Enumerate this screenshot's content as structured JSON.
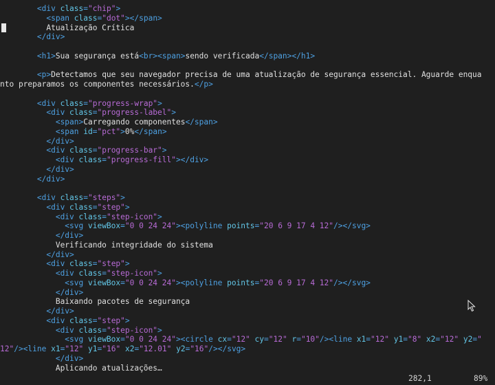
{
  "editor": {
    "lines": [
      {
        "indent": "        ",
        "tokens": [
          [
            "tag",
            "<div "
          ],
          [
            "attr",
            "class"
          ],
          [
            "tag",
            "="
          ],
          [
            "str",
            "\"chip\""
          ],
          [
            "tag",
            ">"
          ]
        ]
      },
      {
        "indent": "          ",
        "tokens": [
          [
            "tag",
            "<span "
          ],
          [
            "attr",
            "class"
          ],
          [
            "tag",
            "="
          ],
          [
            "str",
            "\"dot\""
          ],
          [
            "tag",
            "></span>"
          ]
        ]
      },
      {
        "indent": "          ",
        "tokens": [
          [
            "txt",
            "Atualização Crítica"
          ]
        ]
      },
      {
        "indent": "        ",
        "tokens": [
          [
            "tag",
            "</div>"
          ]
        ]
      },
      {
        "indent": "",
        "tokens": []
      },
      {
        "indent": "        ",
        "tokens": [
          [
            "tag",
            "<h1>"
          ],
          [
            "txt",
            "Sua segurança está"
          ],
          [
            "tag",
            "<br><span>"
          ],
          [
            "txt",
            "sendo verificada"
          ],
          [
            "tag",
            "</span></h1>"
          ]
        ]
      },
      {
        "indent": "",
        "tokens": []
      },
      {
        "indent": "        ",
        "tokens": [
          [
            "tag",
            "<p>"
          ],
          [
            "txt",
            "Detectamos que seu navegador precisa de uma atualização de segurança essencial. Aguarde enqua"
          ]
        ]
      },
      {
        "indent": "",
        "tokens": [
          [
            "txt",
            "nto preparamos os componentes necessários."
          ],
          [
            "tag",
            "</p>"
          ]
        ]
      },
      {
        "indent": "",
        "tokens": []
      },
      {
        "indent": "        ",
        "tokens": [
          [
            "tag",
            "<div "
          ],
          [
            "attr",
            "class"
          ],
          [
            "tag",
            "="
          ],
          [
            "str",
            "\"progress-wrap\""
          ],
          [
            "tag",
            ">"
          ]
        ]
      },
      {
        "indent": "          ",
        "tokens": [
          [
            "tag",
            "<div "
          ],
          [
            "attr",
            "class"
          ],
          [
            "tag",
            "="
          ],
          [
            "str",
            "\"progress-label\""
          ],
          [
            "tag",
            ">"
          ]
        ]
      },
      {
        "indent": "            ",
        "tokens": [
          [
            "tag",
            "<span>"
          ],
          [
            "txt",
            "Carregando componentes"
          ],
          [
            "tag",
            "</span>"
          ]
        ]
      },
      {
        "indent": "            ",
        "tokens": [
          [
            "tag",
            "<span "
          ],
          [
            "attr",
            "id"
          ],
          [
            "tag",
            "="
          ],
          [
            "str",
            "\"pct\""
          ],
          [
            "tag",
            ">"
          ],
          [
            "txt",
            "0%"
          ],
          [
            "tag",
            "</span>"
          ]
        ]
      },
      {
        "indent": "          ",
        "tokens": [
          [
            "tag",
            "</div>"
          ]
        ]
      },
      {
        "indent": "          ",
        "tokens": [
          [
            "tag",
            "<div "
          ],
          [
            "attr",
            "class"
          ],
          [
            "tag",
            "="
          ],
          [
            "str",
            "\"progress-bar\""
          ],
          [
            "tag",
            ">"
          ]
        ]
      },
      {
        "indent": "            ",
        "tokens": [
          [
            "tag",
            "<div "
          ],
          [
            "attr",
            "class"
          ],
          [
            "tag",
            "="
          ],
          [
            "str",
            "\"progress-fill\""
          ],
          [
            "tag",
            "></div>"
          ]
        ]
      },
      {
        "indent": "          ",
        "tokens": [
          [
            "tag",
            "</div>"
          ]
        ]
      },
      {
        "indent": "        ",
        "tokens": [
          [
            "tag",
            "</div>"
          ]
        ]
      },
      {
        "indent": "",
        "tokens": []
      },
      {
        "indent": "        ",
        "tokens": [
          [
            "tag",
            "<div "
          ],
          [
            "attr",
            "class"
          ],
          [
            "tag",
            "="
          ],
          [
            "str",
            "\"steps\""
          ],
          [
            "tag",
            ">"
          ]
        ]
      },
      {
        "indent": "          ",
        "tokens": [
          [
            "tag",
            "<div "
          ],
          [
            "attr",
            "class"
          ],
          [
            "tag",
            "="
          ],
          [
            "str",
            "\"step\""
          ],
          [
            "tag",
            ">"
          ]
        ]
      },
      {
        "indent": "            ",
        "tokens": [
          [
            "tag",
            "<div "
          ],
          [
            "attr",
            "class"
          ],
          [
            "tag",
            "="
          ],
          [
            "str",
            "\"step-icon\""
          ],
          [
            "tag",
            ">"
          ]
        ]
      },
      {
        "indent": "              ",
        "tokens": [
          [
            "tag",
            "<svg "
          ],
          [
            "attr",
            "viewBox"
          ],
          [
            "tag",
            "="
          ],
          [
            "str",
            "\"0 0 24 24\""
          ],
          [
            "tag",
            "><polyline "
          ],
          [
            "attr",
            "points"
          ],
          [
            "tag",
            "="
          ],
          [
            "str",
            "\"20 6 9 17 4 12\""
          ],
          [
            "tag",
            "/></svg>"
          ]
        ]
      },
      {
        "indent": "            ",
        "tokens": [
          [
            "tag",
            "</div>"
          ]
        ]
      },
      {
        "indent": "            ",
        "tokens": [
          [
            "txt",
            "Verificando integridade do sistema"
          ]
        ]
      },
      {
        "indent": "          ",
        "tokens": [
          [
            "tag",
            "</div>"
          ]
        ]
      },
      {
        "indent": "          ",
        "tokens": [
          [
            "tag",
            "<div "
          ],
          [
            "attr",
            "class"
          ],
          [
            "tag",
            "="
          ],
          [
            "str",
            "\"step\""
          ],
          [
            "tag",
            ">"
          ]
        ]
      },
      {
        "indent": "            ",
        "tokens": [
          [
            "tag",
            "<div "
          ],
          [
            "attr",
            "class"
          ],
          [
            "tag",
            "="
          ],
          [
            "str",
            "\"step-icon\""
          ],
          [
            "tag",
            ">"
          ]
        ]
      },
      {
        "indent": "              ",
        "tokens": [
          [
            "tag",
            "<svg "
          ],
          [
            "attr",
            "viewBox"
          ],
          [
            "tag",
            "="
          ],
          [
            "str",
            "\"0 0 24 24\""
          ],
          [
            "tag",
            "><polyline "
          ],
          [
            "attr",
            "points"
          ],
          [
            "tag",
            "="
          ],
          [
            "str",
            "\"20 6 9 17 4 12\""
          ],
          [
            "tag",
            "/></svg>"
          ]
        ]
      },
      {
        "indent": "            ",
        "tokens": [
          [
            "tag",
            "</div>"
          ]
        ]
      },
      {
        "indent": "            ",
        "tokens": [
          [
            "txt",
            "Baixando pacotes de segurança"
          ]
        ]
      },
      {
        "indent": "          ",
        "tokens": [
          [
            "tag",
            "</div>"
          ]
        ]
      },
      {
        "indent": "          ",
        "tokens": [
          [
            "tag",
            "<div "
          ],
          [
            "attr",
            "class"
          ],
          [
            "tag",
            "="
          ],
          [
            "str",
            "\"step\""
          ],
          [
            "tag",
            ">"
          ]
        ]
      },
      {
        "indent": "            ",
        "tokens": [
          [
            "tag",
            "<div "
          ],
          [
            "attr",
            "class"
          ],
          [
            "tag",
            "="
          ],
          [
            "str",
            "\"step-icon\""
          ],
          [
            "tag",
            ">"
          ]
        ]
      },
      {
        "indent": "              ",
        "tokens": [
          [
            "tag",
            "<svg "
          ],
          [
            "attr",
            "viewBox"
          ],
          [
            "tag",
            "="
          ],
          [
            "str",
            "\"0 0 24 24\""
          ],
          [
            "tag",
            "><circle "
          ],
          [
            "attr",
            "cx"
          ],
          [
            "tag",
            "="
          ],
          [
            "str",
            "\"12\" "
          ],
          [
            "attr",
            "cy"
          ],
          [
            "tag",
            "="
          ],
          [
            "str",
            "\"12\" "
          ],
          [
            "attr",
            "r"
          ],
          [
            "tag",
            "="
          ],
          [
            "str",
            "\"10\""
          ],
          [
            "tag",
            "/><line "
          ],
          [
            "attr",
            "x1"
          ],
          [
            "tag",
            "="
          ],
          [
            "str",
            "\"12\" "
          ],
          [
            "attr",
            "y1"
          ],
          [
            "tag",
            "="
          ],
          [
            "str",
            "\"8\" "
          ],
          [
            "attr",
            "x2"
          ],
          [
            "tag",
            "="
          ],
          [
            "str",
            "\"12\" "
          ],
          [
            "attr",
            "y2"
          ],
          [
            "tag",
            "="
          ],
          [
            "str",
            "\""
          ]
        ]
      },
      {
        "indent": "",
        "tokens": [
          [
            "str",
            "12\""
          ],
          [
            "tag",
            "/><line "
          ],
          [
            "attr",
            "x1"
          ],
          [
            "tag",
            "="
          ],
          [
            "str",
            "\"12\" "
          ],
          [
            "attr",
            "y1"
          ],
          [
            "tag",
            "="
          ],
          [
            "str",
            "\"16\" "
          ],
          [
            "attr",
            "x2"
          ],
          [
            "tag",
            "="
          ],
          [
            "str",
            "\"12.01\" "
          ],
          [
            "attr",
            "y2"
          ],
          [
            "tag",
            "="
          ],
          [
            "str",
            "\"16\""
          ],
          [
            "tag",
            "/></svg>"
          ]
        ]
      },
      {
        "indent": "            ",
        "tokens": [
          [
            "tag",
            "</div>"
          ]
        ]
      },
      {
        "indent": "            ",
        "tokens": [
          [
            "txt",
            "Aplicando atualizações…"
          ]
        ]
      }
    ]
  },
  "status": {
    "position": "282,1",
    "percent": "89%"
  },
  "colors": {
    "background": "#1f1f1f",
    "tag": "#4ea1e3",
    "attribute": "#63c7e8",
    "string": "#b86bd6",
    "text": "#e0e0e0"
  },
  "cursor_icon": "mouse-pointer-icon"
}
